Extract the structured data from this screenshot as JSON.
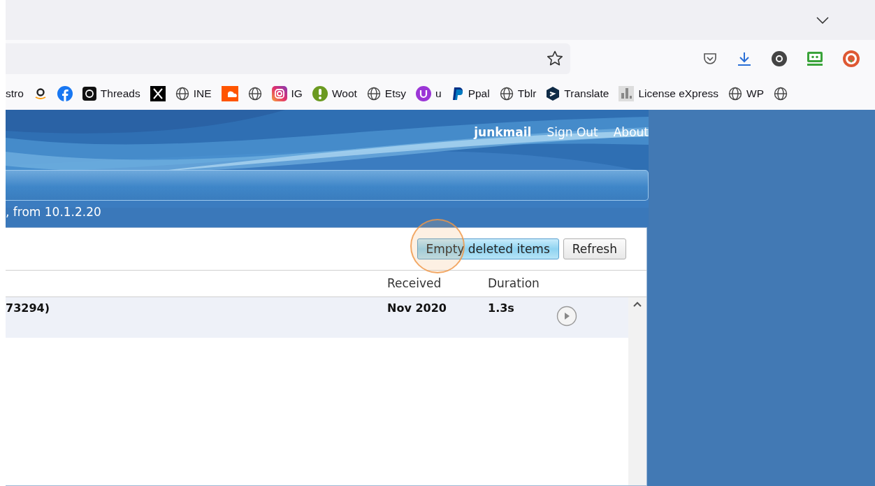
{
  "bookmarks": [
    {
      "kind": "labeled",
      "label": "stro"
    },
    {
      "kind": "icon"
    },
    {
      "kind": "icon"
    },
    {
      "kind": "labeled",
      "label": "Threads"
    },
    {
      "kind": "icon"
    },
    {
      "kind": "labeled",
      "label": "INE"
    },
    {
      "kind": "icon"
    },
    {
      "kind": "icon"
    },
    {
      "kind": "labeled",
      "label": "IG"
    },
    {
      "kind": "labeled",
      "label": "Woot"
    },
    {
      "kind": "labeled",
      "label": "Etsy"
    },
    {
      "kind": "labeled",
      "label": "u"
    },
    {
      "kind": "labeled",
      "label": "Ppal"
    },
    {
      "kind": "labeled",
      "label": "Tblr"
    },
    {
      "kind": "labeled",
      "label": "Translate"
    },
    {
      "kind": "labeled",
      "label": "License eXpress"
    },
    {
      "kind": "labeled",
      "label": "WP"
    },
    {
      "kind": "icon"
    }
  ],
  "user_menu": {
    "username": "junkmail",
    "links": [
      "Sign Out",
      "About"
    ]
  },
  "status_line": ", from 10.1.2.20",
  "toolbar": [
    {
      "label": "Empty deleted items",
      "highlighted": true
    },
    {
      "label": "Refresh",
      "highlighted": false
    }
  ],
  "table": {
    "columns": [
      "Received",
      "Duration"
    ],
    "rows": [
      {
        "column_1": "73294)",
        "received": "Nov 2020",
        "duration": "1.3s",
        "unread": true
      }
    ]
  }
}
